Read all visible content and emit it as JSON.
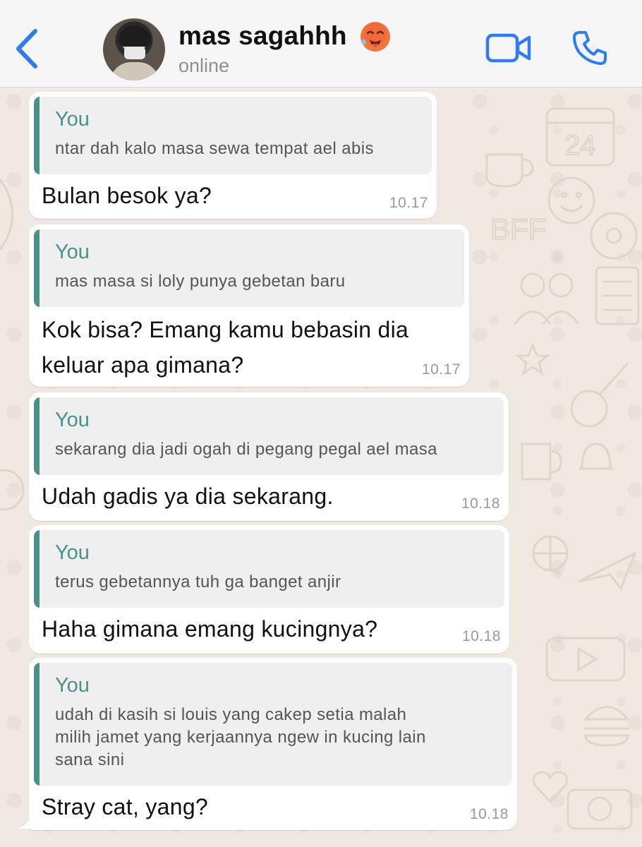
{
  "header": {
    "contact_name": "mas sagahhh",
    "status": "online",
    "accent_color": "#2c7cf6"
  },
  "messages": [
    {
      "quote_author": "You",
      "quote_text": "ntar dah kalo masa sewa tempat ael abis",
      "text": "Bulan besok ya?",
      "time": "10.17"
    },
    {
      "quote_author": "You",
      "quote_text": "mas masa si loly punya gebetan baru",
      "text_lines": [
        "Kok bisa? Emang kamu bebasin dia",
        "keluar apa gimana?"
      ],
      "time": "10.17"
    },
    {
      "quote_author": "You",
      "quote_text": "sekarang dia jadi ogah di pegang pegal ael masa",
      "text": "Udah gadis ya dia sekarang.",
      "time": "10.18"
    },
    {
      "quote_author": "You",
      "quote_text": "terus gebetannya tuh ga banget anjir",
      "text": "Haha gimana emang kucingnya?",
      "time": "10.18"
    },
    {
      "quote_author": "You",
      "quote_text_lines": [
        "udah di kasih si louis yang cakep setia malah",
        "milih jamet yang kerjaannya ngew in kucing lain",
        "sana sini"
      ],
      "text": "Stray cat, yang?",
      "time": "10.18"
    }
  ],
  "icons": {
    "back": "chevron-left-icon",
    "video": "video-camera-icon",
    "call": "phone-icon",
    "emoji": "hot-face-emoji"
  },
  "colors": {
    "quote_accent": "#4a9289",
    "bubble": "#ffffff",
    "wallpaper": "#efe9e1"
  }
}
